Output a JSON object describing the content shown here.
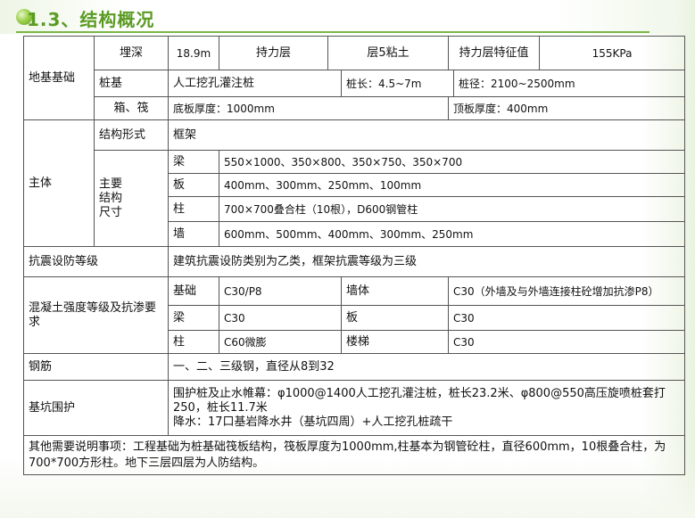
{
  "header": {
    "title": "1.3、结构概况"
  },
  "foundation": {
    "label": "地基基础",
    "depth_label": "埋深",
    "depth_value": "18.9m",
    "bearing_layer_label": "持力层",
    "bearing_layer_value": "层5粘土",
    "bearing_char_label": "持力层特征值",
    "bearing_char_value": "155KPa",
    "pile_label": "桩基",
    "pile_value": "人工挖孔灌注桩",
    "pile_length": "桩长：4.5~7m",
    "pile_diameter": "桩径：2100~2500mm",
    "box_label": "箱、筏",
    "base_thickness": "底板厚度：1000mm",
    "top_thickness": "顶板厚度：400mm"
  },
  "main_body": {
    "label": "主体",
    "form_label": "结构形式",
    "form_value": "框架",
    "size_label_1": "主要",
    "size_label_2": "结构",
    "size_label_3": "尺寸",
    "rows": [
      {
        "label": "梁",
        "value": "550×1000、350×800、350×750、350×700"
      },
      {
        "label": "板",
        "value": "400mm、300mm、250mm、100mm"
      },
      {
        "label": "柱",
        "value": "700×700叠合柱（10根），D600钢管柱"
      },
      {
        "label": "墙",
        "value": "600mm、500mm、400mm、300mm、250mm"
      }
    ]
  },
  "seismic": {
    "label": "抗震设防等级",
    "value": "建筑抗震设防类别为乙类，框架抗震等级为三级"
  },
  "concrete": {
    "label": "混凝土强度等级及抗渗要求",
    "rows": [
      {
        "a_label": "基础",
        "a_value": "C30/P8",
        "b_label": "墙体",
        "b_value": "C30（外墙及与外墙连接柱砼增加抗渗P8）"
      },
      {
        "a_label": "梁",
        "a_value": "C30",
        "b_label": "板",
        "b_value": "C30"
      },
      {
        "a_label": "柱",
        "a_value": "C60微膨",
        "b_label": "楼梯",
        "b_value": "C30"
      }
    ]
  },
  "rebar": {
    "label": "钢筋",
    "value": "一、二、三级钢，直径从8到32"
  },
  "pit": {
    "label": "基坑围护",
    "line1": "围护桩及止水帷幕：φ1000@1400人工挖孔灌注桩，桩长23.2米、φ800@550高压旋喷桩套打250，桩长11.7米",
    "line2": "降水：17口基岩降水井（基坑四周）+人工挖孔桩疏干"
  },
  "note": {
    "text": "其他需要说明事项：工程基础为桩基础筏板结构，筏板厚度为1000mm,柱基本为钢管砼柱，直径600mm，10根叠合柱，为700*700方形柱。地下三层四层为人防结构。"
  },
  "colors": {
    "title": "#5b9b24",
    "rule": "#7ab648",
    "border": "#555555"
  }
}
